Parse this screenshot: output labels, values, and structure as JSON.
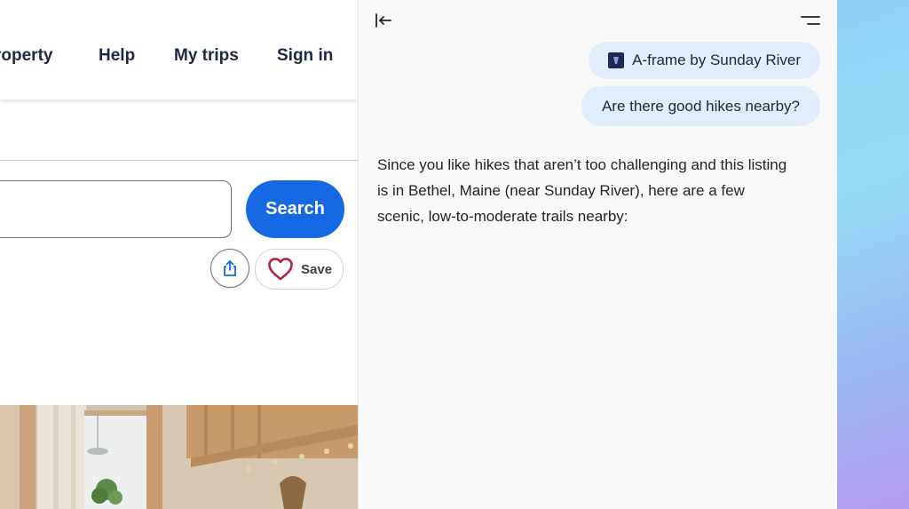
{
  "site": {
    "nav": {
      "property": "roperty",
      "help": "Help",
      "my_trips": "My trips",
      "sign_in": "Sign in"
    },
    "search": {
      "button_label": "Search",
      "input_value": ""
    },
    "actions": {
      "save_label": "Save"
    },
    "colors": {
      "primary": "#1668e3",
      "heart": "#b3203a",
      "nav_text": "#1f2746"
    }
  },
  "assistant": {
    "context_chip": "A-frame by Sunday River",
    "user_message": "Are there good hikes nearby?",
    "response": "Since you like hikes that aren’t too challenging and this listing is in Bethel, Maine (near Sunday River), here are a few scenic, low-to-moderate trails nearby:",
    "colors": {
      "bubble": "#e2edfc",
      "panel_bg": "#f9f9f9"
    }
  },
  "icons": {
    "collapse": "collapse-sidebar-icon",
    "menu": "menu-icon",
    "share": "share-icon",
    "heart": "heart-icon",
    "document": "document-icon"
  }
}
